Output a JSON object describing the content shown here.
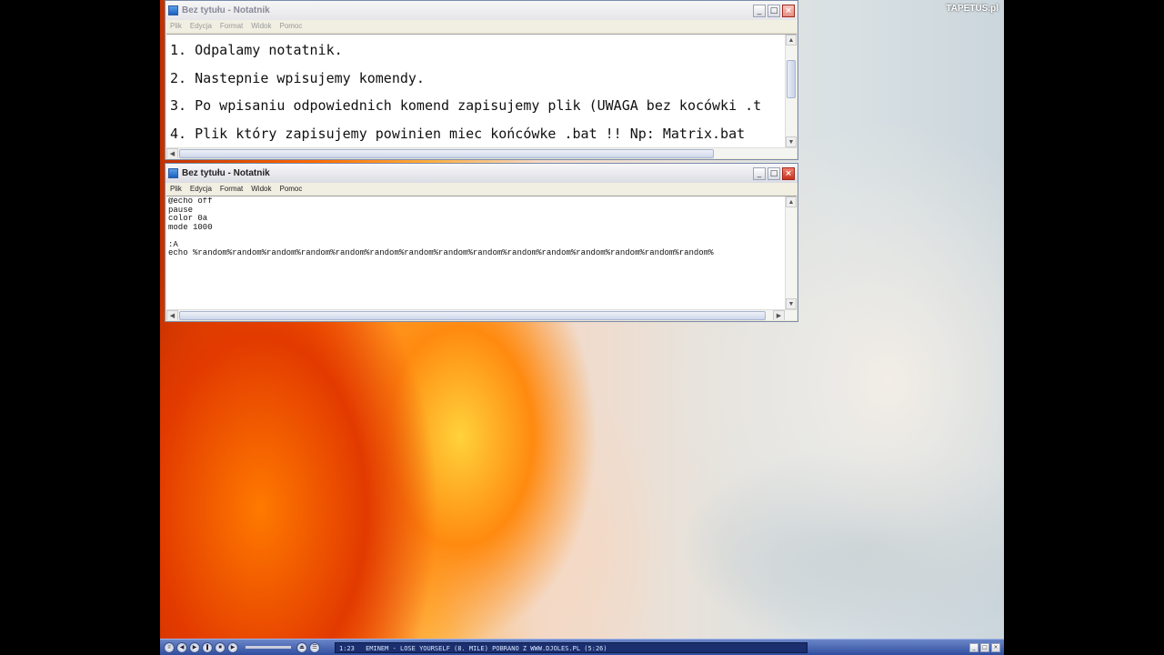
{
  "watermark": "TAPETUS.pl",
  "window_top": {
    "title": "Bez tytułu - Notatnik",
    "menu": [
      "Plik",
      "Edycja",
      "Format",
      "Widok",
      "Pomoc"
    ],
    "lines": [
      "1. Odpalamy notatnik.",
      "2. Nastepnie wpisujemy komendy.",
      "3. Po wpisaniu odpowiednich komend zapisujemy plik (UWAGA bez kocówki .t",
      "4. Plik który zapisujemy powinien miec końcówke .bat !! Np:  Matrix.bat"
    ]
  },
  "window_bottom": {
    "title": "Bez tytułu - Notatnik",
    "menu": [
      "Plik",
      "Edycja",
      "Format",
      "Widok",
      "Pomoc"
    ],
    "lines": [
      "@echo off",
      "pause",
      "color 0a",
      "mode 1000",
      "",
      ":A",
      "echo %random%random%random%random%random%random%random%random%random%random%random%random%random%random%random%"
    ]
  },
  "media_player": {
    "time": "1:23",
    "track": "EMINEM - LOSE YOURSELF (8. MILE) POBRANO Z WWW.DJOLES.PL (5:26)"
  }
}
